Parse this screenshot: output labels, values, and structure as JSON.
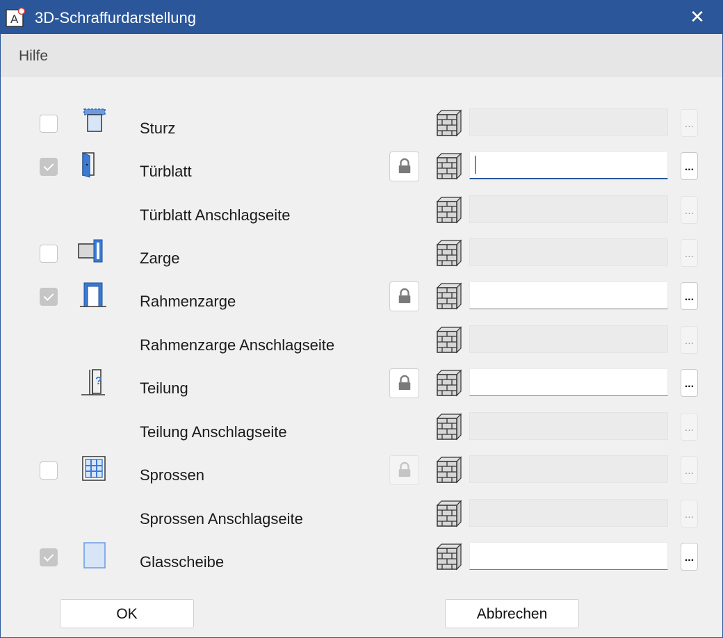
{
  "window": {
    "title": "3D-Schraffurdarstellung"
  },
  "menu": {
    "help": "Hilfe"
  },
  "rows": [
    {
      "label": "Sturz",
      "checkbox": "unchecked",
      "icon": "lintel-icon",
      "lock": null,
      "field_active": false,
      "value": ""
    },
    {
      "label": "Türblatt",
      "checkbox": "checked-disabled",
      "icon": "door-leaf-icon",
      "lock": "enabled",
      "field_active": true,
      "focused": true,
      "value": ""
    },
    {
      "label": "Türblatt Anschlagseite",
      "checkbox": null,
      "icon": null,
      "lock": null,
      "field_active": false,
      "value": ""
    },
    {
      "label": "Zarge",
      "checkbox": "unchecked",
      "icon": "frame-icon",
      "lock": null,
      "field_active": false,
      "value": ""
    },
    {
      "label": "Rahmenzarge",
      "checkbox": "checked-disabled",
      "icon": "frame-case-icon",
      "lock": "enabled",
      "field_active": true,
      "value": ""
    },
    {
      "label": "Rahmenzarge Anschlagseite",
      "checkbox": null,
      "icon": null,
      "lock": null,
      "field_active": false,
      "value": ""
    },
    {
      "label": "Teilung",
      "checkbox": null,
      "icon": "division-icon",
      "lock": "enabled",
      "field_active": true,
      "value": ""
    },
    {
      "label": "Teilung Anschlagseite",
      "checkbox": null,
      "icon": null,
      "lock": null,
      "field_active": false,
      "value": ""
    },
    {
      "label": "Sprossen",
      "checkbox": "unchecked",
      "icon": "muntins-icon",
      "lock": "disabled",
      "field_active": false,
      "value": ""
    },
    {
      "label": "Sprossen Anschlagseite",
      "checkbox": null,
      "icon": null,
      "lock": null,
      "field_active": false,
      "value": ""
    },
    {
      "label": "Glasscheibe",
      "checkbox": "checked-disabled",
      "icon": "glass-pane-icon",
      "lock": null,
      "field_active": true,
      "value": ""
    }
  ],
  "ellipsis": "...",
  "buttons": {
    "ok": "OK",
    "cancel": "Abbrechen"
  },
  "colors": {
    "titlebar": "#2b579a",
    "icon_blue": "#3a7bd5"
  }
}
